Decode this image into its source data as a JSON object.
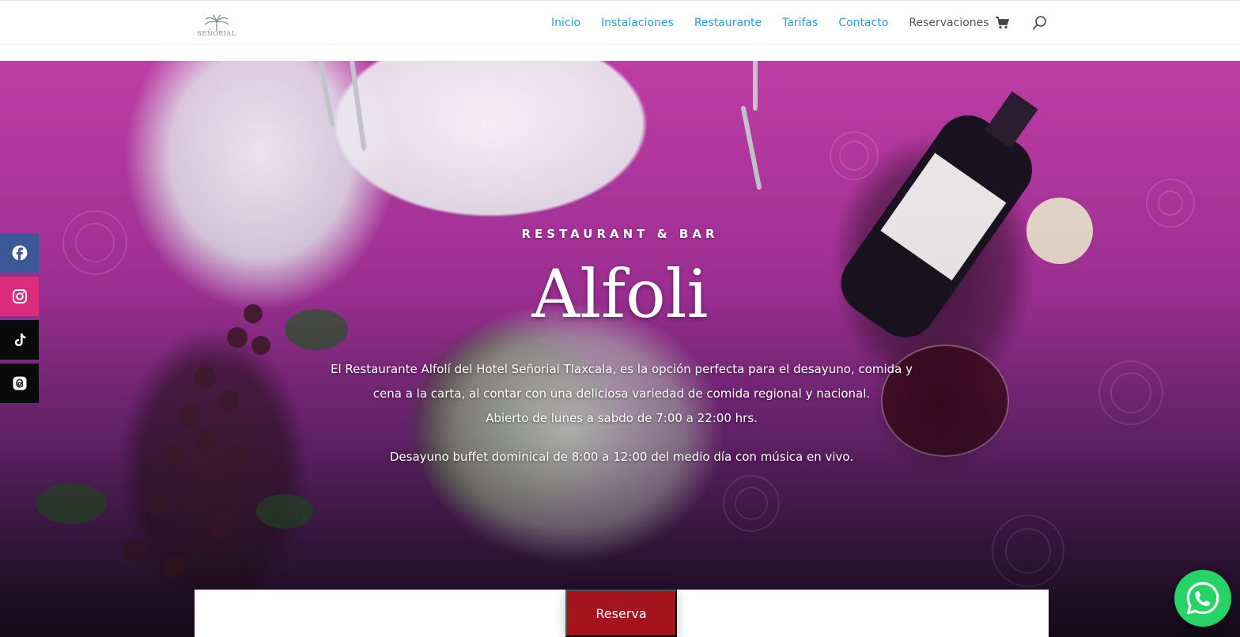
{
  "header": {
    "logo_text": "SEÑORIAL",
    "nav": [
      {
        "label": "Inicio",
        "color": "#2e9bd6"
      },
      {
        "label": "Instalaciones",
        "color": "#2e9bd6"
      },
      {
        "label": "Restaurante",
        "color": "#2e9bd6"
      },
      {
        "label": "Tarifas",
        "color": "#2e9bd6"
      },
      {
        "label": "Contacto",
        "color": "#2e9bd6"
      },
      {
        "label": "Reservaciones",
        "color": "#555555"
      }
    ],
    "icons": {
      "cart": "shopping-cart-icon",
      "search": "search-icon"
    }
  },
  "hero": {
    "kicker": "RESTAURANT & BAR",
    "title": "Alfoli",
    "desc_line1": "El Restaurante Alfolí del Hotel Señorial Tlaxcala, es la opción perfecta para el desayuno, comida y cena a la carta, al contar con una deliciosa variedad de comida regional y nacional.",
    "desc_line2": "Abierto de lunes a sabdo de 7:00 a 22:00 hrs.",
    "desc_line3": "Desayuno buffet dominical de 8:00 a 12:00 del medio día con música en vivo."
  },
  "social": [
    {
      "name": "facebook-icon",
      "color": "#3b5998"
    },
    {
      "name": "instagram-icon",
      "color": "#dc2d7a"
    },
    {
      "name": "tiktok-icon",
      "color": "#0a0a0a"
    },
    {
      "name": "threads-icon",
      "color": "#0a0a0a"
    }
  ],
  "cta": {
    "label": "Reserva",
    "color": "#a3141c"
  },
  "whatsapp": {
    "icon": "whatsapp-icon",
    "color": "#25d366"
  },
  "colors": {
    "accent": "#2e9bd6",
    "brand_red": "#a3141c"
  }
}
